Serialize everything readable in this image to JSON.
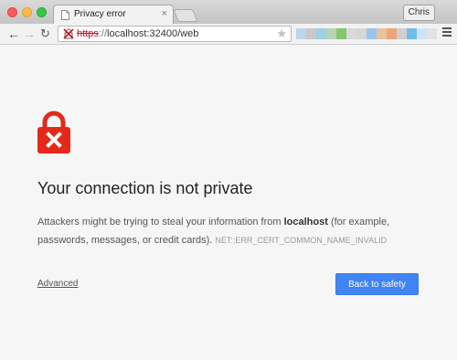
{
  "window": {
    "controls": [
      "close",
      "minimize",
      "maximize"
    ]
  },
  "tab": {
    "title": "Privacy error",
    "favicon": "page-icon",
    "close_label": "×"
  },
  "profile": {
    "name": "Chris"
  },
  "toolbar": {
    "back_icon": "back-arrow-icon",
    "forward_icon": "forward-arrow-icon",
    "reload_icon": "reload-icon",
    "url_scheme": "https",
    "url_separator": "://",
    "url_rest": "localhost:32400/web",
    "security_icon": "broken-lock-icon",
    "star_icon": "bookmark-star-icon",
    "menu_icon": "hamburger-menu-icon"
  },
  "extensions": {
    "note_colors": [
      "#bcd6ec",
      "#c9c9c9",
      "#9cd0e6",
      "#b9d2b4",
      "#86c66c",
      "#d9d9d9",
      "#d6d6d6",
      "#9ac5ef",
      "#e9c29b",
      "#f0a37a",
      "#cfcfcf",
      "#6fbde8",
      "#cfe3f4",
      "#e2e2e2"
    ]
  },
  "error_page": {
    "icon": "red-padlock-icon",
    "accent_color": "#e32a1a",
    "heading": "Your connection is not private",
    "message_before": "Attackers might be trying to steal your information from ",
    "host": "localhost",
    "message_after": " (for example, passwords, messages, or credit cards).",
    "error_code": "NET::ERR_CERT_COMMON_NAME_INVALID",
    "advanced_label": "Advanced",
    "safety_button_label": "Back to safety",
    "button_color": "#4184f3"
  }
}
